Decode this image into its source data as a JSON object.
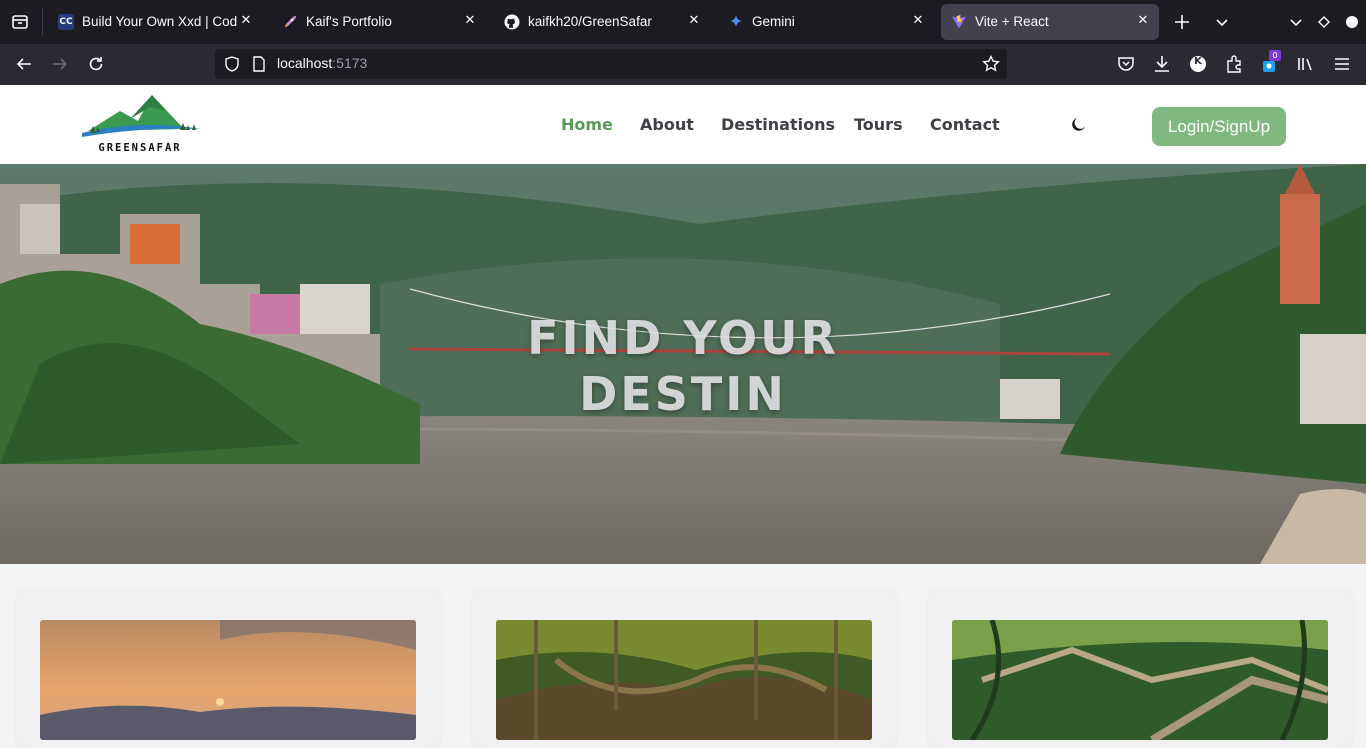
{
  "browser": {
    "tabs": [
      {
        "title": "Build Your Own Xxd | Codi",
        "favicon": "codecrafters-icon",
        "active": false
      },
      {
        "title": "Kaif's Portfolio",
        "favicon": "rocket-icon",
        "active": false
      },
      {
        "title": "kaifkh20/GreenSafar",
        "favicon": "github-icon",
        "active": false
      },
      {
        "title": "Gemini",
        "favicon": "gemini-sparkle-icon",
        "active": false
      },
      {
        "title": "Vite + React",
        "favicon": "vite-icon",
        "active": true
      }
    ],
    "url_host": "localhost",
    "url_port": ":5173",
    "extension_badge": "0",
    "profile_initial": "K"
  },
  "site": {
    "logo_text": "GREENSAFAR",
    "nav": [
      {
        "label": "Home",
        "active": true
      },
      {
        "label": "About",
        "active": false
      },
      {
        "label": "Destinations",
        "active": false
      },
      {
        "label": "Tours",
        "active": false
      },
      {
        "label": "Contact",
        "active": false
      }
    ],
    "theme_toggle_icon": "moon-icon",
    "login_label": "Login/SignUp",
    "accent_color": "#5a9a5a",
    "button_color": "#7fb97f"
  },
  "hero": {
    "title_line1": "FIND YOUR",
    "title_line2": "DESTIN"
  },
  "cards": [
    {
      "image": "sunset-mountains"
    },
    {
      "image": "living-root-bridge-forest"
    },
    {
      "image": "forest-stairway"
    }
  ]
}
